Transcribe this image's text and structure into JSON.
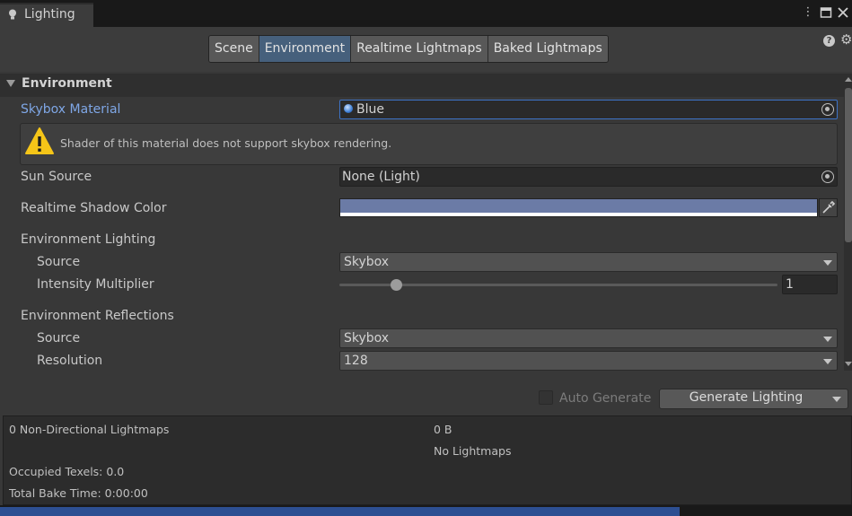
{
  "window": {
    "tab_title": "Lighting",
    "icons": [
      "lightbulb-icon",
      "kebab-menu-icon",
      "maximize-icon",
      "close-icon",
      "help-icon",
      "settings-icon"
    ]
  },
  "tabs": [
    {
      "label": "Scene",
      "active": false
    },
    {
      "label": "Environment",
      "active": true
    },
    {
      "label": "Realtime Lightmaps",
      "active": false
    },
    {
      "label": "Baked Lightmaps",
      "active": false
    }
  ],
  "section": {
    "title": "Environment"
  },
  "skybox": {
    "label": "Skybox Material",
    "value": "Blue"
  },
  "warning": {
    "text": "Shader of this material does not support skybox rendering."
  },
  "sun": {
    "label": "Sun Source",
    "value": "None (Light)"
  },
  "shadow": {
    "label": "Realtime Shadow Color",
    "color": "#6b7ba6"
  },
  "env_lighting": {
    "title": "Environment Lighting",
    "source_label": "Source",
    "source_value": "Skybox",
    "intensity_label": "Intensity Multiplier",
    "intensity_value": "1",
    "slider_fraction": 0.13
  },
  "env_reflections": {
    "title": "Environment Reflections",
    "source_label": "Source",
    "source_value": "Skybox",
    "resolution_label": "Resolution",
    "resolution_value": "128"
  },
  "generate": {
    "auto_label": "Auto Generate",
    "auto_checked": false,
    "button_label": "Generate Lighting"
  },
  "info": {
    "lightmaps": "0 Non-Directional Lightmaps",
    "size": "0 B",
    "status": "No Lightmaps",
    "texels": "Occupied Texels: 0.0",
    "bake_time": "Total Bake Time: 0:00:00"
  },
  "colors": {
    "accent_blue": "#7fa7e6",
    "active_tab": "#46607c",
    "warning_yellow": "#f5c518"
  }
}
